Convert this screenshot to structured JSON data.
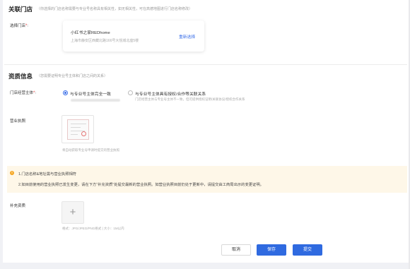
{
  "store_section": {
    "title": "关联门店",
    "hint": "（你选择的门店名称需要与专业号名称具有相关性，如无相关性，可在高德地图进行门店名称修改）",
    "select_label": "选择门店",
    "store_name": "小红书之家REDhome",
    "store_address": "上海市静安区西藏北路166号大悦城北座5楼",
    "reselect": "重新选择"
  },
  "qualification_section": {
    "title": "资质信息",
    "hint": "（您需要证明专业号主体和门店之间的关系）",
    "operator_label": "门店经营主体",
    "options": [
      {
        "label": "与专业号主体完全一致",
        "selected": true
      },
      {
        "label": "与专业号主体具有授权/合作等关联关系",
        "selected": false,
        "sub": "门店经营主体与专业号主体不一致，但可提供授权证明/关联协议/授权合作关系"
      }
    ],
    "license_label": "营业执照",
    "license_hint": "将自动获取专业号申请时提交的营业执照"
  },
  "notice": {
    "icon": "warning-icon",
    "line1": "1.门店名称&地址需与营业执照相符",
    "line2": "2.如目前使用的营业执照已发生变更，请在下方“补充资质”处提交最新的营业执照。如营业执照目前仍处于更新中，请提交由工商局出示的变更证明。"
  },
  "supplement": {
    "label": "补充资质",
    "upload_symbol": "+",
    "format_hint": "格式：JPG/JPEG/PNG格式 | 大小：1M以内"
  },
  "actions": {
    "cancel": "取消",
    "save": "保存",
    "submit": "提交"
  },
  "colors": {
    "primary": "#2f6ae0",
    "required": "#e53935",
    "notice_bg": "#fef7e8",
    "warning": "#f5a623"
  }
}
